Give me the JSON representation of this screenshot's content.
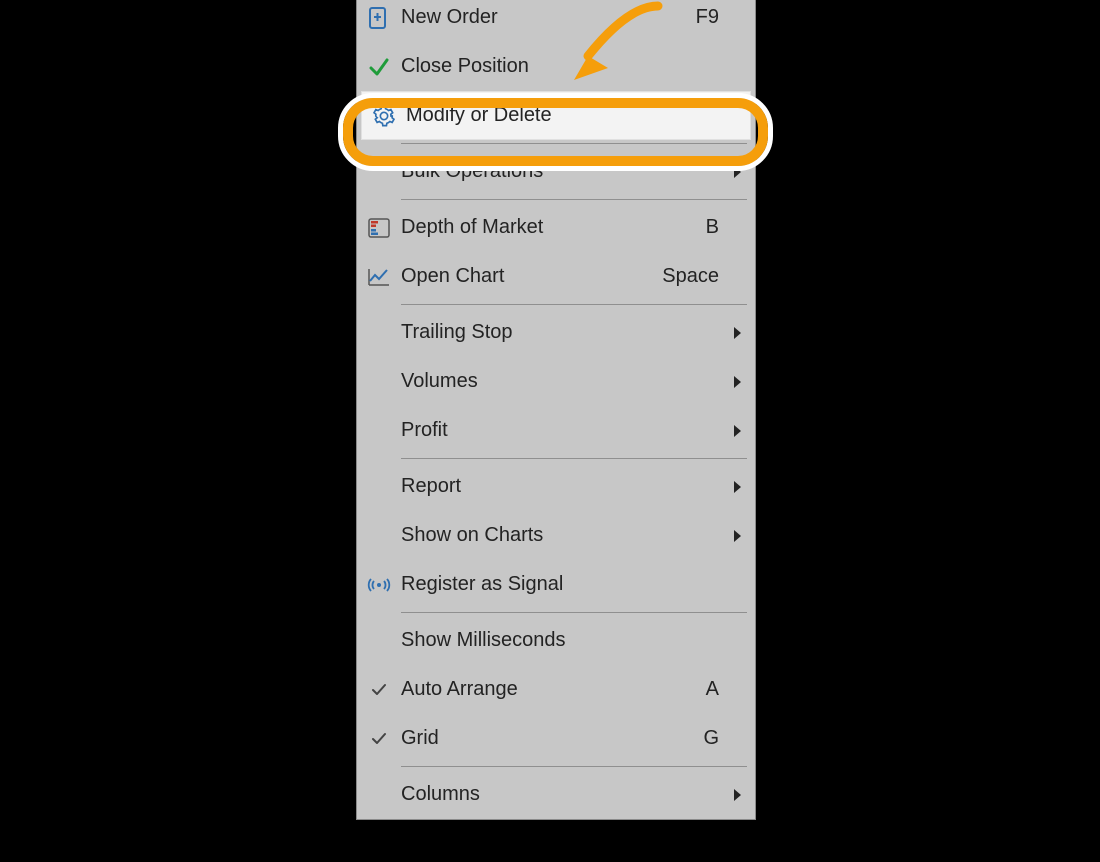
{
  "menu": {
    "groups": [
      [
        {
          "id": "new-order",
          "label": "New Order",
          "shortcut": "F9",
          "icon": "plus-doc",
          "submenu": false,
          "checked": false,
          "highlight": false
        },
        {
          "id": "close-position",
          "label": "Close Position",
          "shortcut": "",
          "icon": "check-green",
          "submenu": false,
          "checked": false,
          "highlight": false
        },
        {
          "id": "modify-or-delete",
          "label": "Modify or Delete",
          "shortcut": "",
          "icon": "gear-blue",
          "submenu": false,
          "checked": false,
          "highlight": true
        }
      ],
      [
        {
          "id": "bulk-operations",
          "label": "Bulk Operations",
          "shortcut": "",
          "icon": "",
          "submenu": true,
          "checked": false,
          "highlight": false
        }
      ],
      [
        {
          "id": "depth-of-market",
          "label": "Depth of Market",
          "shortcut": "B",
          "icon": "depth",
          "submenu": false,
          "checked": false,
          "highlight": false
        },
        {
          "id": "open-chart",
          "label": "Open Chart",
          "shortcut": "Space",
          "icon": "chart-line",
          "submenu": false,
          "checked": false,
          "highlight": false
        }
      ],
      [
        {
          "id": "trailing-stop",
          "label": "Trailing Stop",
          "shortcut": "",
          "icon": "",
          "submenu": true,
          "checked": false,
          "highlight": false
        },
        {
          "id": "volumes",
          "label": "Volumes",
          "shortcut": "",
          "icon": "",
          "submenu": true,
          "checked": false,
          "highlight": false
        },
        {
          "id": "profit",
          "label": "Profit",
          "shortcut": "",
          "icon": "",
          "submenu": true,
          "checked": false,
          "highlight": false
        }
      ],
      [
        {
          "id": "report",
          "label": "Report",
          "shortcut": "",
          "icon": "",
          "submenu": true,
          "checked": false,
          "highlight": false
        },
        {
          "id": "show-on-charts",
          "label": "Show on Charts",
          "shortcut": "",
          "icon": "",
          "submenu": true,
          "checked": false,
          "highlight": false
        },
        {
          "id": "register-as-signal",
          "label": "Register as Signal",
          "shortcut": "",
          "icon": "signal",
          "submenu": false,
          "checked": false,
          "highlight": false
        }
      ],
      [
        {
          "id": "show-milliseconds",
          "label": "Show Milliseconds",
          "shortcut": "",
          "icon": "",
          "submenu": false,
          "checked": false,
          "highlight": false
        },
        {
          "id": "auto-arrange",
          "label": "Auto Arrange",
          "shortcut": "A",
          "icon": "",
          "submenu": false,
          "checked": true,
          "highlight": false
        },
        {
          "id": "grid",
          "label": "Grid",
          "shortcut": "G",
          "icon": "",
          "submenu": false,
          "checked": true,
          "highlight": false
        }
      ],
      [
        {
          "id": "columns",
          "label": "Columns",
          "shortcut": "",
          "icon": "",
          "submenu": true,
          "checked": false,
          "highlight": false
        }
      ]
    ]
  },
  "colors": {
    "accent": "#f59e0b",
    "icon_blue": "#2f6fb0",
    "icon_green": "#1f9c3a",
    "icon_red": "#c0392b"
  }
}
